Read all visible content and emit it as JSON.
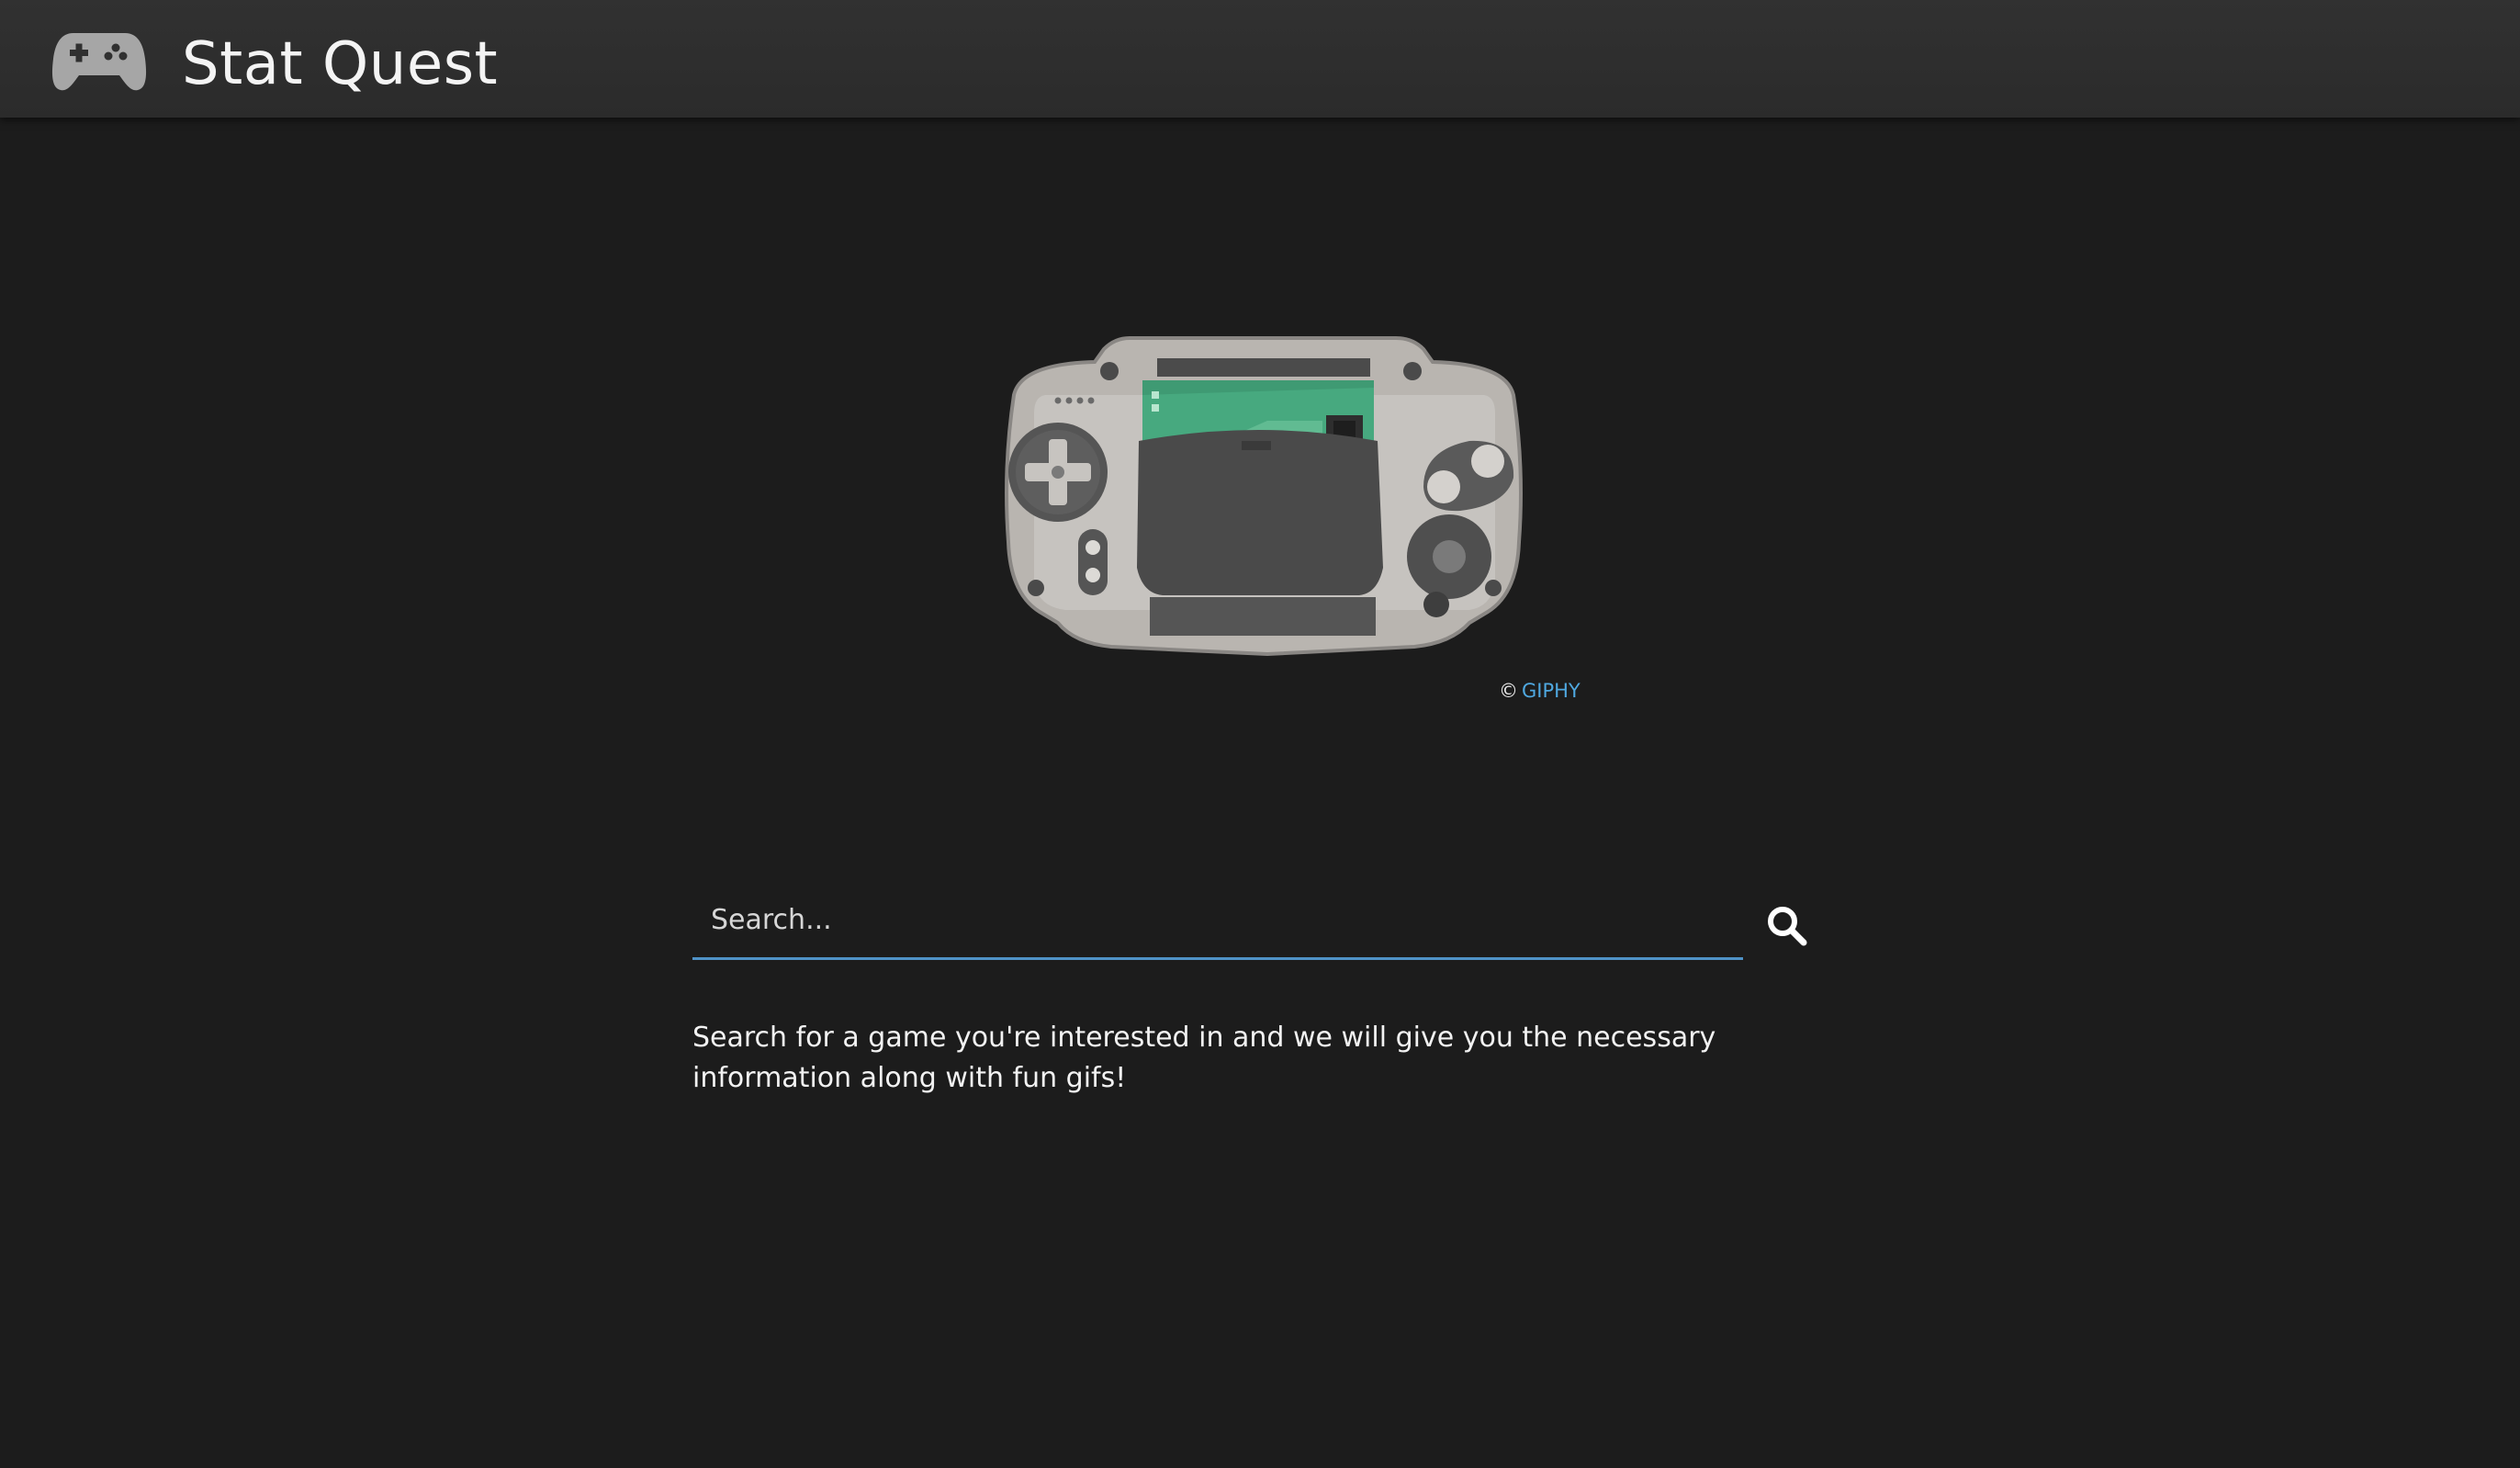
{
  "header": {
    "title": "Stat Quest",
    "logo_icon": "gamepad-icon"
  },
  "hero": {
    "image_icon": "game-boy-advance-illustration",
    "credit_symbol": "©",
    "credit_link": "GIPHY"
  },
  "search": {
    "placeholder": "Search...",
    "value": "",
    "button_icon": "search-icon"
  },
  "description": "Search for a game you're interested in and we will give you the necessary information along with fun gifs!",
  "colors": {
    "background": "#1c1c1c",
    "navbar": "#2f2f2f",
    "accent": "#4f92c7",
    "link": "#4fa8e0"
  }
}
